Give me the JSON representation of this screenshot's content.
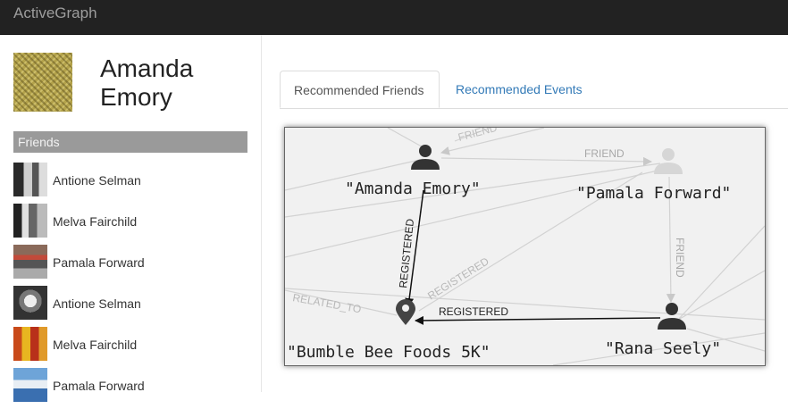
{
  "app": {
    "title": "ActiveGraph"
  },
  "profile": {
    "name": "Amanda Emory"
  },
  "friends": {
    "header": "Friends",
    "items": [
      {
        "name": "Antione Selman"
      },
      {
        "name": "Melva Fairchild"
      },
      {
        "name": "Pamala Forward"
      },
      {
        "name": "Antione Selman"
      },
      {
        "name": "Melva Fairchild"
      },
      {
        "name": "Pamala Forward"
      }
    ]
  },
  "tabs": [
    {
      "label": "Recommended Friends",
      "active": true
    },
    {
      "label": "Recommended Events",
      "active": false
    }
  ],
  "graph": {
    "nodes": {
      "amanda": "\"Amanda Emory\"",
      "pamala": "\"Pamala Forward\"",
      "bumble": "\"Bumble Bee Foods 5K\"",
      "rana": "\"Rana Seely\""
    },
    "edges": {
      "friend_top": "FRIEND",
      "friend_faded_top": "FRIEND",
      "friend_vertical": "FRIEND",
      "registered_amanda": "REGISTERED",
      "registered_diag": "REGISTERED",
      "registered_rana": "REGISTERED",
      "related_to": "RELATED_TO"
    }
  },
  "colors": {
    "navbar": "#222222",
    "link": "#337ab7",
    "friends_header": "#9a9a9a"
  }
}
